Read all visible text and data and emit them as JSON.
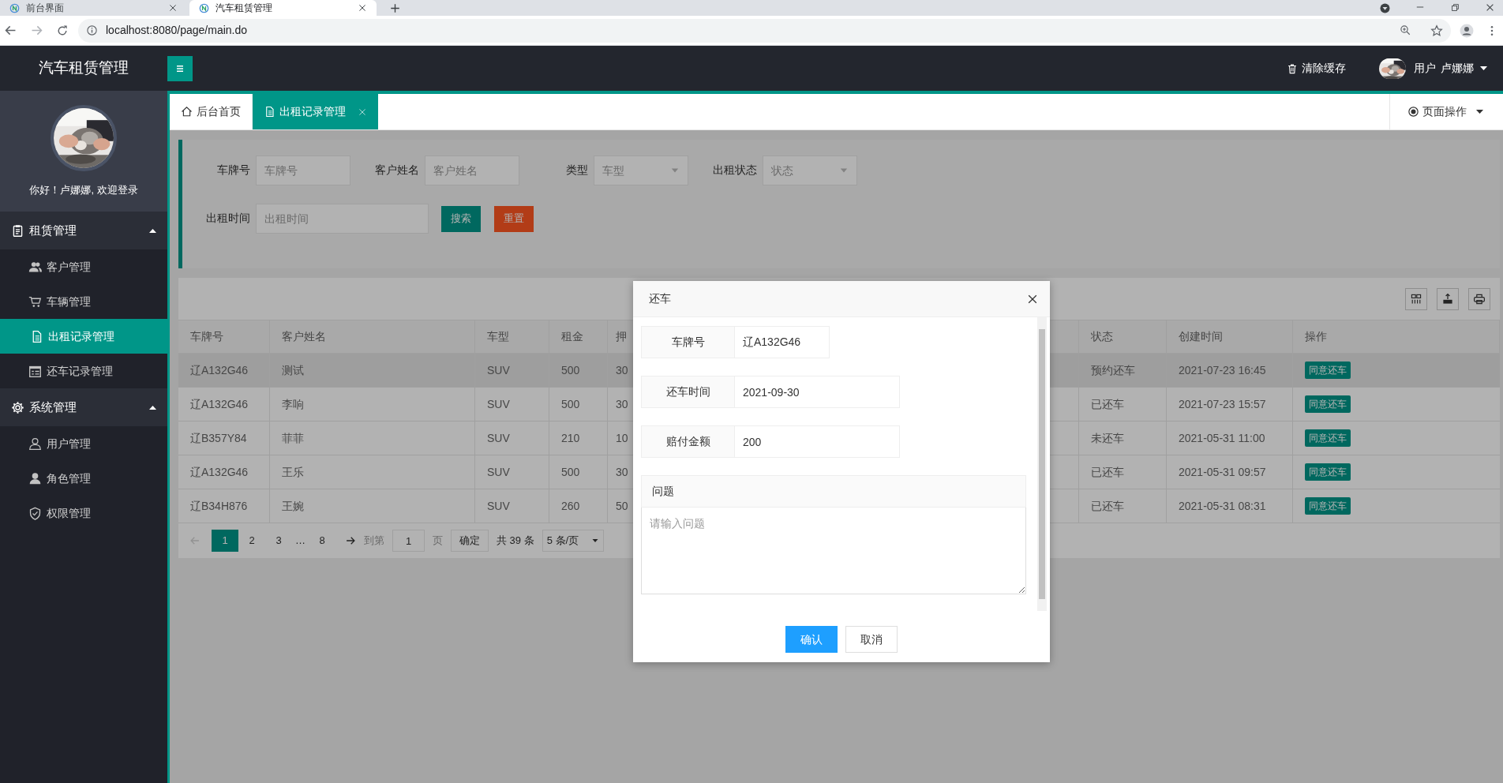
{
  "browser": {
    "tabs": [
      {
        "title": "前台界面",
        "selected": false
      },
      {
        "title": "汽车租赁管理",
        "selected": true
      }
    ],
    "url": "localhost:8080/page/main.do"
  },
  "header": {
    "title": "汽车租赁管理",
    "clear_cache": "清除缓存",
    "user_label": "用户",
    "user_name": "卢娜娜"
  },
  "sidebar": {
    "welcome": "你好！卢娜娜, 欢迎登录",
    "groups": [
      {
        "label": "租赁管理",
        "expanded": true,
        "items": [
          {
            "label": "客户管理",
            "selected": false
          },
          {
            "label": "车辆管理",
            "selected": false
          },
          {
            "label": "出租记录管理",
            "selected": true
          },
          {
            "label": "还车记录管理",
            "selected": false
          }
        ]
      },
      {
        "label": "系统管理",
        "expanded": true,
        "items": [
          {
            "label": "用户管理",
            "selected": false
          },
          {
            "label": "角色管理",
            "selected": false
          },
          {
            "label": "权限管理",
            "selected": false
          }
        ]
      }
    ]
  },
  "page_tabs": [
    {
      "label": "后台首页",
      "selected": false,
      "closable": false
    },
    {
      "label": "出租记录管理",
      "selected": true,
      "closable": true
    }
  ],
  "page_ops": "页面操作",
  "filters": {
    "fields": [
      {
        "label": "车牌号",
        "placeholder": "车牌号",
        "kind": "text"
      },
      {
        "label": "客户姓名",
        "placeholder": "客户姓名",
        "kind": "text"
      },
      {
        "label": "类型",
        "placeholder": "车型",
        "kind": "select"
      },
      {
        "label": "出租状态",
        "placeholder": "状态",
        "kind": "select"
      },
      {
        "label": "出租时间",
        "placeholder": "出租时间",
        "kind": "wide"
      }
    ],
    "buttons": [
      {
        "label": "搜索",
        "kind": "primary"
      },
      {
        "label": "重置",
        "kind": "danger"
      }
    ]
  },
  "table": {
    "columns": [
      "车牌号",
      "客户姓名",
      "车型",
      "租金",
      "押",
      "状态",
      "创建时间",
      "操作"
    ],
    "rows": [
      {
        "cells": [
          "辽A132G46",
          "测试",
          "SUV",
          "500",
          "30",
          "预约还车",
          "2021-07-23 16:45"
        ],
        "action": "同意还车",
        "hovered": true
      },
      {
        "cells": [
          "辽A132G46",
          "李响",
          "SUV",
          "500",
          "30",
          "已还车",
          "2021-07-23 15:57"
        ],
        "action": "同意还车",
        "hovered": false
      },
      {
        "cells": [
          "辽B357Y84",
          "菲菲",
          "SUV",
          "210",
          "10",
          "未还车",
          "2021-05-31 11:00"
        ],
        "action": "同意还车",
        "hovered": false
      },
      {
        "cells": [
          "辽A132G46",
          "王乐",
          "SUV",
          "500",
          "30",
          "已还车",
          "2021-05-31 09:57"
        ],
        "action": "同意还车",
        "hovered": false
      },
      {
        "cells": [
          "辽B34H876",
          "王婉",
          "SUV",
          "260",
          "50",
          "已还车",
          "2021-05-31 08:31"
        ],
        "action": "同意还车",
        "hovered": false
      }
    ]
  },
  "pagination": {
    "pages": [
      {
        "label": "1",
        "kind": "page",
        "selected": true
      },
      {
        "label": "2",
        "kind": "page",
        "selected": false
      },
      {
        "label": "3",
        "kind": "page",
        "selected": false
      },
      {
        "label": "…",
        "kind": "ellipsis"
      },
      {
        "label": "8",
        "kind": "page",
        "selected": false
      }
    ],
    "goto_label": "到第",
    "goto_value": "1",
    "page_unit": "页",
    "confirm": "确定",
    "total": "共 39 条",
    "page_size": "5 条/页"
  },
  "dialog": {
    "title": "还车",
    "fields": [
      {
        "label": "车牌号",
        "value": "辽A132G46",
        "kind": "short"
      },
      {
        "label": "还车时间",
        "value": "2021-09-30",
        "kind": "long"
      },
      {
        "label": "赔付金额",
        "value": "200",
        "kind": "long"
      }
    ],
    "textarea": {
      "label": "问题",
      "placeholder": "请输入问题"
    },
    "buttons": [
      {
        "label": "确认",
        "kind": "primary"
      },
      {
        "label": "取消",
        "kind": "default"
      }
    ]
  }
}
